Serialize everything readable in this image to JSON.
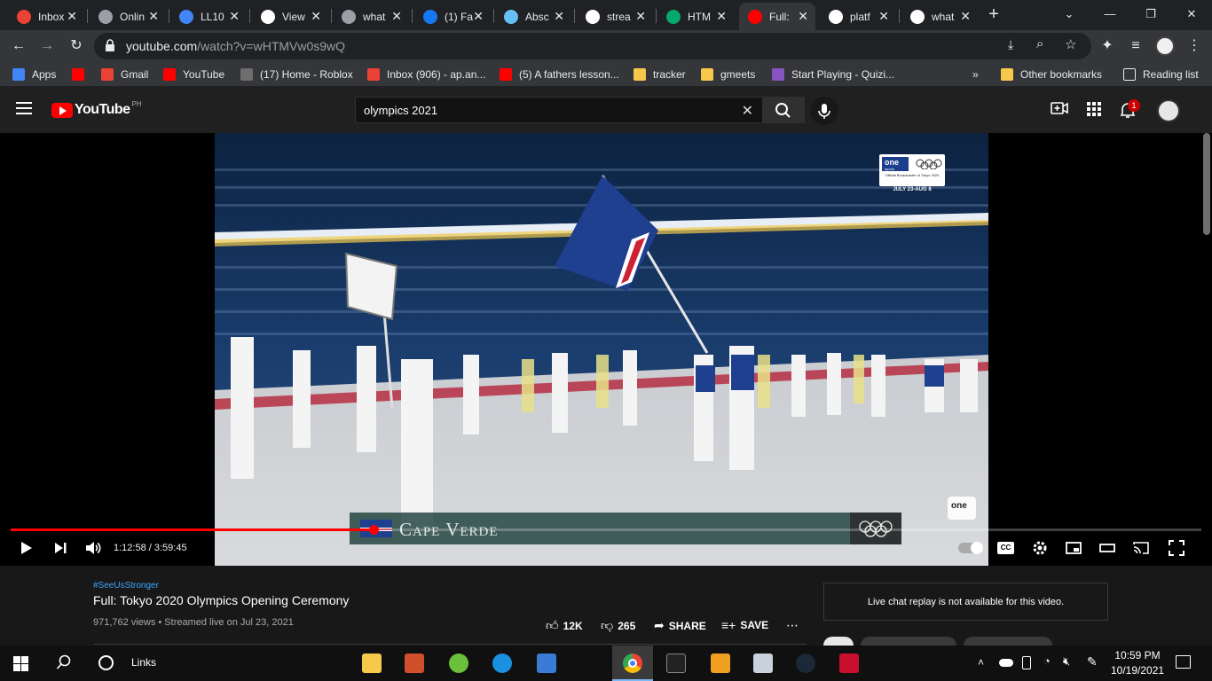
{
  "browser": {
    "tabs": [
      {
        "label": "Inbox",
        "icon": "gmail-icon",
        "color": "#ea4335"
      },
      {
        "label": "Onlin",
        "icon": "globe-icon",
        "color": "#9aa0a6"
      },
      {
        "label": "LL10",
        "icon": "docs-icon",
        "color": "#4285f4"
      },
      {
        "label": "View",
        "icon": "google-icon",
        "color": "#ffffff"
      },
      {
        "label": "what",
        "icon": "globe-icon",
        "color": "#9aa0a6"
      },
      {
        "label": "(1) Fa",
        "icon": "facebook-icon",
        "color": "#1877f2"
      },
      {
        "label": "Absc",
        "icon": "steam-icon",
        "color": "#66c0f4"
      },
      {
        "label": "strea",
        "icon": "google-icon",
        "color": "#ffffff"
      },
      {
        "label": "HTM",
        "icon": "w3schools-icon",
        "color": "#04aa6d"
      },
      {
        "label": "Full:",
        "icon": "youtube-icon",
        "color": "#ff0000"
      },
      {
        "label": "platf",
        "icon": "google-icon",
        "color": "#ffffff"
      },
      {
        "label": "what",
        "icon": "google-icon",
        "color": "#ffffff"
      }
    ],
    "active_tab_index": 9,
    "new_tab": "+",
    "url_host": "youtube.com",
    "url_path": "/watch?v=wHTMVw0s9wQ",
    "bookmarks": [
      {
        "label": "Apps",
        "icon": "apps-grid-icon"
      },
      {
        "label": "",
        "icon": "youtube-icon"
      },
      {
        "label": "Gmail",
        "icon": "gmail-icon"
      },
      {
        "label": "YouTube",
        "icon": "youtube-icon"
      },
      {
        "label": "(17) Home - Roblox",
        "icon": "roblox-icon"
      },
      {
        "label": "Inbox (906) - ap.an...",
        "icon": "gmail-icon"
      },
      {
        "label": "(5) A fathers lesson...",
        "icon": "youtube-icon"
      },
      {
        "label": "tracker",
        "icon": "folder-icon"
      },
      {
        "label": "gmeets",
        "icon": "folder-icon"
      },
      {
        "label": "Start Playing - Quizi...",
        "icon": "quizizz-icon"
      }
    ],
    "bookmarks_overflow": "»",
    "other_bookmarks": "Other bookmarks",
    "reading_list": "Reading list"
  },
  "youtube": {
    "logo_text": "YouTube",
    "country_code": "PH",
    "search_query": "olympics 2021",
    "notification_count": "1"
  },
  "player": {
    "lower_third_country": "Cape Verde",
    "broadcaster_badge": "one",
    "broadcaster_sub": "sports",
    "broadcaster_note": "Official Broadcaster of Tokyo 2020",
    "broadcaster_dates": "JULY 23-AUG 8",
    "current_time": "1:12:58",
    "duration": "3:59:45",
    "progress": 0.3045,
    "cc_label": "CC"
  },
  "video": {
    "hashtag": "#SeeUsStronger",
    "title": "Full: Tokyo 2020 Olympics Opening Ceremony",
    "views": "971,762 views",
    "streamed": "Streamed live on Jul 23, 2021",
    "likes": "12K",
    "dislikes": "265",
    "share": "SHARE",
    "save": "SAVE",
    "chat_notice": "Live chat replay is not available for this video."
  },
  "taskbar": {
    "search_text": "Links",
    "time": "10:59 PM",
    "date": "10/19/2021"
  }
}
